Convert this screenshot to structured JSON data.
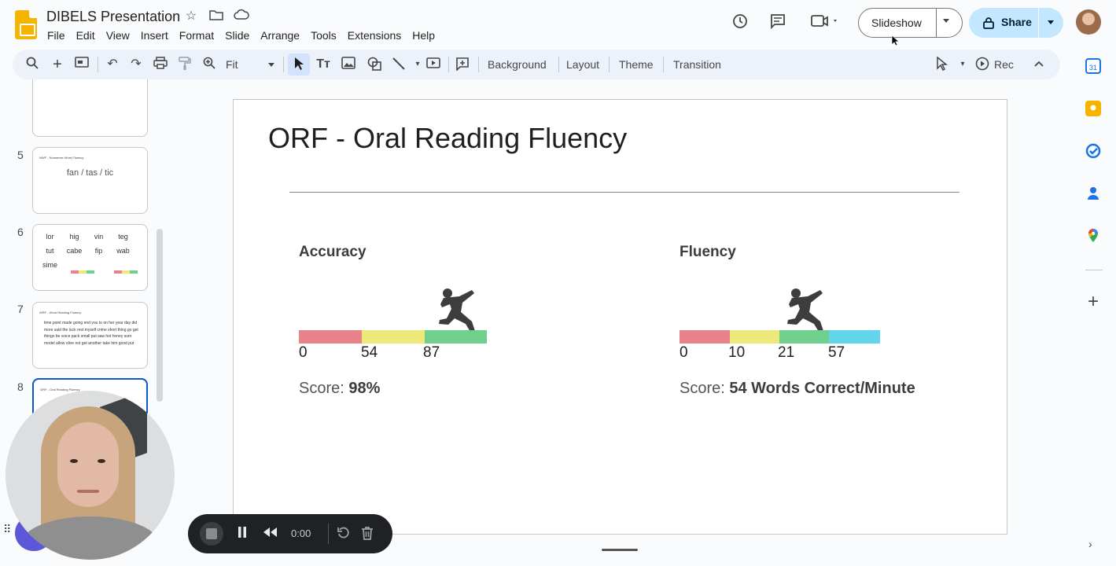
{
  "header": {
    "doc_title": "DIBELS Presentation",
    "menu": [
      "File",
      "Edit",
      "View",
      "Insert",
      "Format",
      "Slide",
      "Arrange",
      "Tools",
      "Extensions",
      "Help"
    ],
    "slideshow_label": "Slideshow",
    "share_label": "Share"
  },
  "toolbar": {
    "zoom_value": "Fit",
    "background_label": "Background",
    "layout_label": "Layout",
    "theme_label": "Theme",
    "transition_label": "Transition",
    "rec_label": "Rec"
  },
  "filmstrip": {
    "items": [
      {
        "number": "5",
        "title": "NWF - Nonsense Word Fluency",
        "text": "fan / tas / tic"
      },
      {
        "number": "6",
        "words": [
          "lor",
          "hig",
          "vin",
          "teg",
          "tut",
          "cabe",
          "fip",
          "wab",
          "sime"
        ]
      },
      {
        "number": "7",
        "title": "WRF - Word Reading Fluency",
        "words": "time point made going end you to on her year day did more said the luck rest myself crime short thing go get things be voice pack small put saw hot honey sum model allow olive not get another take him good put"
      },
      {
        "number": "8",
        "title": "ORF - Oral Reading Fluency"
      }
    ]
  },
  "slide": {
    "title": "ORF - Oral Reading Fluency",
    "accuracy": {
      "label": "Accuracy",
      "ticks": [
        "0",
        "54",
        "87"
      ],
      "score_prefix": "Score: ",
      "score_value": "98%"
    },
    "fluency": {
      "label": "Fluency",
      "ticks": [
        "0",
        "10",
        "21",
        "57"
      ],
      "score_prefix": "Score: ",
      "score_value": "54 Words Correct/Minute"
    }
  },
  "recorder": {
    "time": "0:00"
  },
  "colors": {
    "red_band": "#e8838c",
    "yellow_band": "#ece87a",
    "green_band": "#6fd08e",
    "blue_band": "#62d4ec",
    "accent": "#0b57d0",
    "share_bg": "#c2e7ff"
  }
}
